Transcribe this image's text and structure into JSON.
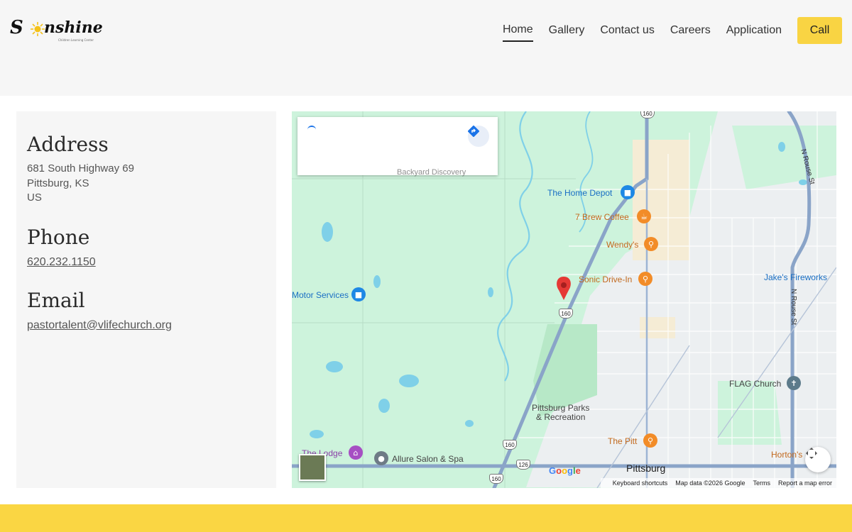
{
  "header": {
    "logo": {
      "text_s": "S",
      "text_rest": "nshine",
      "tagline": "Children Learning Center"
    },
    "nav": [
      {
        "label": "Home",
        "active": true
      },
      {
        "label": "Gallery",
        "active": false
      },
      {
        "label": "Contact us",
        "active": false
      },
      {
        "label": "Careers",
        "active": false
      },
      {
        "label": "Application",
        "active": false
      }
    ],
    "call_label": "Call"
  },
  "contact": {
    "address_heading": "Address",
    "address_lines": [
      "681 South Highway 69",
      "Pittsburg, KS",
      "US"
    ],
    "phone_heading": "Phone",
    "phone": "620.232.1150",
    "email_heading": "Email",
    "email": "pastortalent@vlifechurch.org"
  },
  "map": {
    "places": [
      {
        "name": "The Home Depot",
        "color": "blue",
        "icon": "shopping-bag-icon"
      },
      {
        "name": "7 Brew Coffee",
        "color": "orange",
        "icon": "coffee-icon"
      },
      {
        "name": "Wendy's",
        "color": "orange",
        "icon": "restaurant-icon"
      },
      {
        "name": "Sonic Drive-In",
        "color": "orange",
        "icon": "restaurant-icon"
      },
      {
        "name": "Jake's Fireworks",
        "color": "blue",
        "icon": ""
      },
      {
        "name": "Motor Services",
        "color": "blue",
        "icon": "shopping-bag-icon"
      },
      {
        "name": "FLAG Church",
        "color": "dark",
        "icon": "church-icon"
      },
      {
        "name": "Pittsburg Parks\n& Recreation",
        "color": "dark",
        "icon": ""
      },
      {
        "name": "The Pitt",
        "color": "orange",
        "icon": "restaurant-icon"
      },
      {
        "name": "The Lodge",
        "color": "purple",
        "icon": "lodging-icon"
      },
      {
        "name": "Allure Salon & Spa",
        "color": "dark",
        "icon": "pin-icon"
      },
      {
        "name": "Horton's",
        "color": "orange",
        "icon": ""
      }
    ],
    "city": "Pittsburg",
    "streets": [
      "N Rouse St",
      "N Rouse St"
    ],
    "routes": [
      "160",
      "160",
      "160",
      "126",
      "160"
    ],
    "card_partial_text": "Backyard Discovery",
    "google": "Google",
    "attribution": [
      "Keyboard shortcuts",
      "Map data ©2026 Google",
      "Terms",
      "Report a map error"
    ]
  },
  "colors": {
    "accent_yellow": "#f9d443",
    "map_green": "#cdf3dc",
    "marker_red": "#e53935"
  }
}
